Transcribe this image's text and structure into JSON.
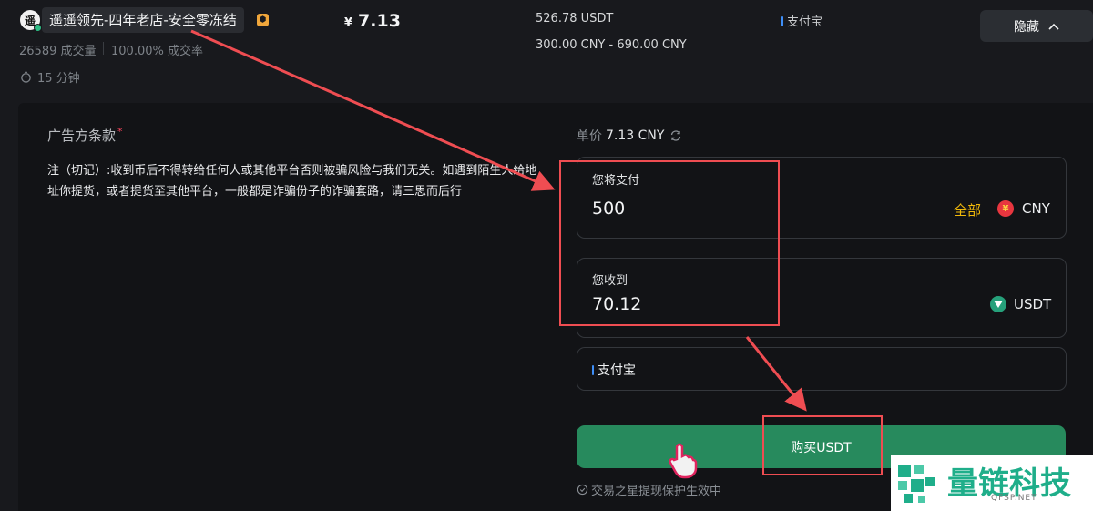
{
  "merchant": {
    "avatar_char": "遥",
    "name": "遥遥领先-四年老店-安全零冻结",
    "badge": "⬢",
    "orders": "26589 成交量",
    "completion": "100.00% 成交率",
    "time": "15 分钟"
  },
  "listing": {
    "price_symbol": "¥",
    "price": "7.13",
    "available": "526.78 USDT",
    "limit": "300.00 CNY - 690.00 CNY",
    "payment": "支付宝"
  },
  "hide_button": "隐藏",
  "terms": {
    "title": "广告方条款",
    "required": "*",
    "text": "注（切记）:收到币后不得转给任何人或其他平台否则被骗风险与我们无关。如遇到陌生人给地址你提货，或者提货至其他平台，一般都是诈骗份子的诈骗套路，请三思而后行"
  },
  "order_form": {
    "unit_price_label": "单价",
    "unit_price_value": "7.13 CNY",
    "pay_label": "您将支付",
    "pay_value": "500",
    "all_label": "全部",
    "pay_currency": "CNY",
    "receive_label": "您收到",
    "receive_value": "70.12",
    "receive_currency": "USDT",
    "payment_method": "支付宝",
    "buy_button": "购买USDT",
    "protection_note": "交易之星提现保护生效中"
  },
  "watermark": {
    "text": "量链科技",
    "sub": "QFSP.NET"
  },
  "colors": {
    "accent_green": "#278a5d",
    "all_yellow": "#f0b90b",
    "annotation_red": "#ef4d52"
  }
}
